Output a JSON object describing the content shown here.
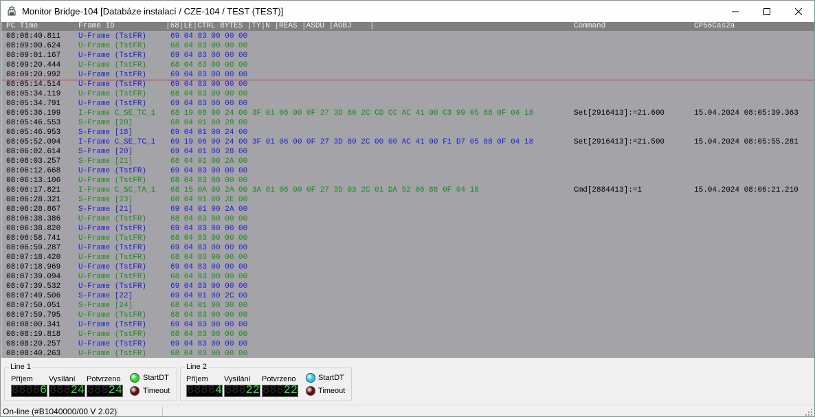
{
  "window": {
    "title": "Monitor Bridge-104 [Databáze instalací / CZE-104 / TEST (TEST)]"
  },
  "log": {
    "headers": {
      "pc_time": "PC Time",
      "frame_id": "Frame ID",
      "bytes": "|68|LE|CTRL BYTES |TY|N |REAS |ASDU |AOBJ    |",
      "command": "Command",
      "cp56": "CP56Cas2a"
    },
    "rows": [
      {
        "time": "08:08:40.811",
        "frame": "U-Frame (TstFR)",
        "bytes": "69 04 83 00 00 00",
        "cmd": "",
        "cp56": "",
        "color": "blue"
      },
      {
        "time": "08:09:00.624",
        "frame": "U-Frame (TstFR)",
        "bytes": "68 04 83 00 00 00",
        "cmd": "",
        "cp56": "",
        "color": "green"
      },
      {
        "time": "08:09:01.167",
        "frame": "U-Frame (TstFR)",
        "bytes": "69 04 83 00 00 00",
        "cmd": "",
        "cp56": "",
        "color": "blue"
      },
      {
        "time": "08:09:20.444",
        "frame": "U-Frame (TstFR)",
        "bytes": "68 04 83 00 00 00",
        "cmd": "",
        "cp56": "",
        "color": "green"
      },
      {
        "time": "08:09:20.992",
        "frame": "U-Frame (TstFR)",
        "bytes": "69 04 83 00 00 00",
        "cmd": "",
        "cp56": "",
        "color": "blue"
      },
      {
        "time": "08:05:14.514",
        "frame": "U-Frame (TstFR)",
        "bytes": "69 04 83 00 00 00",
        "cmd": "",
        "cp56": "",
        "color": "blue"
      },
      {
        "time": "08:05:34.119",
        "frame": "U-Frame (TstFR)",
        "bytes": "68 04 83 00 00 00",
        "cmd": "",
        "cp56": "",
        "color": "green"
      },
      {
        "time": "08:05:34.791",
        "frame": "U-Frame (TstFR)",
        "bytes": "69 04 83 00 00 00",
        "cmd": "",
        "cp56": "",
        "color": "blue"
      },
      {
        "time": "08:05:36.199",
        "frame": "I-Frame C_SE_TC_1",
        "bytes": "68 19 08 00 24 00 3F 01 06 00 0F 27 3D 80 2C CD CC AC 41 00 C3 99 05 88 0F 04 18",
        "cmd": "Set[2916413]:=21.600",
        "cp56": "15.04.2024 08:05:39.363",
        "color": "green"
      },
      {
        "time": "08:05:46.553",
        "frame": "S-Frame [20]",
        "bytes": "68 04 01 00 28 00",
        "cmd": "",
        "cp56": "",
        "color": "green"
      },
      {
        "time": "08:05:46.953",
        "frame": "S-Frame [18]",
        "bytes": "69 04 01 00 24 00",
        "cmd": "",
        "cp56": "",
        "color": "blue"
      },
      {
        "time": "08:05:52.094",
        "frame": "I-Frame C_SE_TC_1",
        "bytes": "69 19 06 00 24 00 3F 01 06 00 0F 27 3D 80 2C 00 00 AC 41 00 F1 D7 05 88 0F 04 18",
        "cmd": "Set[2916413]:=21.500",
        "cp56": "15.04.2024 08:05:55.281",
        "color": "blue"
      },
      {
        "time": "08:06:02.614",
        "frame": "S-Frame [20]",
        "bytes": "69 04 01 00 28 00",
        "cmd": "",
        "cp56": "",
        "color": "blue"
      },
      {
        "time": "08:06:03.257",
        "frame": "S-Frame [21]",
        "bytes": "68 04 01 00 2A 00",
        "cmd": "",
        "cp56": "",
        "color": "green"
      },
      {
        "time": "08:06:12.668",
        "frame": "U-Frame (TstFR)",
        "bytes": "69 04 83 00 00 00",
        "cmd": "",
        "cp56": "",
        "color": "blue"
      },
      {
        "time": "08:06:13.106",
        "frame": "U-Frame (TstFR)",
        "bytes": "68 04 83 00 00 00",
        "cmd": "",
        "cp56": "",
        "color": "green"
      },
      {
        "time": "08:06:17.821",
        "frame": "I-Frame C_SC_TA_1",
        "bytes": "68 15 0A 00 2A 00 3A 01 06 00 0F 27 3D 03 2C 01 DA 52 06 88 0F 04 18",
        "cmd": "Cmd[2884413]:=1",
        "cp56": "15.04.2024 08:06:21.210",
        "color": "green"
      },
      {
        "time": "08:06:28.321",
        "frame": "S-Frame [23]",
        "bytes": "68 04 01 00 2E 00",
        "cmd": "",
        "cp56": "",
        "color": "green"
      },
      {
        "time": "08:06:28.867",
        "frame": "S-Frame [21]",
        "bytes": "69 04 01 00 2A 00",
        "cmd": "",
        "cp56": "",
        "color": "blue"
      },
      {
        "time": "08:06:38.386",
        "frame": "U-Frame (TstFR)",
        "bytes": "68 04 83 00 00 00",
        "cmd": "",
        "cp56": "",
        "color": "green"
      },
      {
        "time": "08:06:38.820",
        "frame": "U-Frame (TstFR)",
        "bytes": "69 04 83 00 00 00",
        "cmd": "",
        "cp56": "",
        "color": "blue"
      },
      {
        "time": "08:06:58.741",
        "frame": "U-Frame (TstFR)",
        "bytes": "68 04 83 00 00 00",
        "cmd": "",
        "cp56": "",
        "color": "green"
      },
      {
        "time": "08:06:59.287",
        "frame": "U-Frame (TstFR)",
        "bytes": "69 04 83 00 00 00",
        "cmd": "",
        "cp56": "",
        "color": "blue"
      },
      {
        "time": "08:07:18.420",
        "frame": "U-Frame (TstFR)",
        "bytes": "68 04 83 00 00 00",
        "cmd": "",
        "cp56": "",
        "color": "green"
      },
      {
        "time": "08:07:18.969",
        "frame": "U-Frame (TstFR)",
        "bytes": "69 04 83 00 00 00",
        "cmd": "",
        "cp56": "",
        "color": "blue"
      },
      {
        "time": "08:07:39.094",
        "frame": "U-Frame (TstFR)",
        "bytes": "68 04 83 00 00 00",
        "cmd": "",
        "cp56": "",
        "color": "green"
      },
      {
        "time": "08:07:39.532",
        "frame": "U-Frame (TstFR)",
        "bytes": "69 04 83 00 00 00",
        "cmd": "",
        "cp56": "",
        "color": "blue"
      },
      {
        "time": "08:07:49.506",
        "frame": "S-Frame [22]",
        "bytes": "69 04 01 00 2C 00",
        "cmd": "",
        "cp56": "",
        "color": "blue"
      },
      {
        "time": "08:07:50.051",
        "frame": "S-Frame [24]",
        "bytes": "68 04 01 00 30 00",
        "cmd": "",
        "cp56": "",
        "color": "green"
      },
      {
        "time": "08:07:59.795",
        "frame": "U-Frame (TstFR)",
        "bytes": "68 04 83 00 00 00",
        "cmd": "",
        "cp56": "",
        "color": "green"
      },
      {
        "time": "08:08:00.341",
        "frame": "U-Frame (TstFR)",
        "bytes": "69 04 83 00 00 00",
        "cmd": "",
        "cp56": "",
        "color": "blue"
      },
      {
        "time": "08:08:19.818",
        "frame": "U-Frame (TstFR)",
        "bytes": "68 04 83 00 00 00",
        "cmd": "",
        "cp56": "",
        "color": "green"
      },
      {
        "time": "08:08:20.257",
        "frame": "U-Frame (TstFR)",
        "bytes": "69 04 83 00 00 00",
        "cmd": "",
        "cp56": "",
        "color": "blue"
      },
      {
        "time": "08:08:40.263",
        "frame": "U-Frame (TstFR)",
        "bytes": "68 04 83 00 00 00",
        "cmd": "",
        "cp56": "",
        "color": "green"
      }
    ]
  },
  "line1": {
    "label": "Line 1",
    "prijem_label": "Příjem",
    "vysilani_label": "Vysílání",
    "potvrzeno_label": "Potvrzeno",
    "prijem": "6",
    "vysilani": "24",
    "potvrzeno": "24",
    "startdt_label": "StartDT",
    "timeout_label": "Timeout",
    "startdt_color": "#22dd22",
    "timeout_color": "#6a0a0a"
  },
  "line2": {
    "label": "Line 2",
    "prijem_label": "Příjem",
    "vysilani_label": "Vysílání",
    "potvrzeno_label": "Potvrzeno",
    "prijem": "4",
    "vysilani": "22",
    "potvrzeno": "22",
    "startdt_label": "StartDT",
    "timeout_label": "Timeout",
    "startdt_color": "#22ccee",
    "timeout_color": "#6a0a0a"
  },
  "status": {
    "text": "On-line (#B1040000/00  V 2.02)"
  },
  "colors": {
    "green": "#1a8a1a",
    "blue": "#1c1cd8",
    "log_bg": "#a3a3a8",
    "header_bg": "#7f7f7f",
    "separator": "#d22222"
  }
}
